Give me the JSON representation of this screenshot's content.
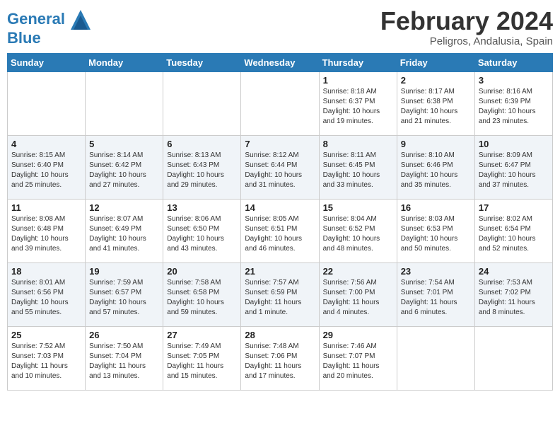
{
  "header": {
    "logo_line1": "General",
    "logo_line2": "Blue",
    "month_year": "February 2024",
    "location": "Peligros, Andalusia, Spain"
  },
  "weekdays": [
    "Sunday",
    "Monday",
    "Tuesday",
    "Wednesday",
    "Thursday",
    "Friday",
    "Saturday"
  ],
  "weeks": [
    [
      {
        "day": "",
        "info": ""
      },
      {
        "day": "",
        "info": ""
      },
      {
        "day": "",
        "info": ""
      },
      {
        "day": "",
        "info": ""
      },
      {
        "day": "1",
        "info": "Sunrise: 8:18 AM\nSunset: 6:37 PM\nDaylight: 10 hours\nand 19 minutes."
      },
      {
        "day": "2",
        "info": "Sunrise: 8:17 AM\nSunset: 6:38 PM\nDaylight: 10 hours\nand 21 minutes."
      },
      {
        "day": "3",
        "info": "Sunrise: 8:16 AM\nSunset: 6:39 PM\nDaylight: 10 hours\nand 23 minutes."
      }
    ],
    [
      {
        "day": "4",
        "info": "Sunrise: 8:15 AM\nSunset: 6:40 PM\nDaylight: 10 hours\nand 25 minutes."
      },
      {
        "day": "5",
        "info": "Sunrise: 8:14 AM\nSunset: 6:42 PM\nDaylight: 10 hours\nand 27 minutes."
      },
      {
        "day": "6",
        "info": "Sunrise: 8:13 AM\nSunset: 6:43 PM\nDaylight: 10 hours\nand 29 minutes."
      },
      {
        "day": "7",
        "info": "Sunrise: 8:12 AM\nSunset: 6:44 PM\nDaylight: 10 hours\nand 31 minutes."
      },
      {
        "day": "8",
        "info": "Sunrise: 8:11 AM\nSunset: 6:45 PM\nDaylight: 10 hours\nand 33 minutes."
      },
      {
        "day": "9",
        "info": "Sunrise: 8:10 AM\nSunset: 6:46 PM\nDaylight: 10 hours\nand 35 minutes."
      },
      {
        "day": "10",
        "info": "Sunrise: 8:09 AM\nSunset: 6:47 PM\nDaylight: 10 hours\nand 37 minutes."
      }
    ],
    [
      {
        "day": "11",
        "info": "Sunrise: 8:08 AM\nSunset: 6:48 PM\nDaylight: 10 hours\nand 39 minutes."
      },
      {
        "day": "12",
        "info": "Sunrise: 8:07 AM\nSunset: 6:49 PM\nDaylight: 10 hours\nand 41 minutes."
      },
      {
        "day": "13",
        "info": "Sunrise: 8:06 AM\nSunset: 6:50 PM\nDaylight: 10 hours\nand 43 minutes."
      },
      {
        "day": "14",
        "info": "Sunrise: 8:05 AM\nSunset: 6:51 PM\nDaylight: 10 hours\nand 46 minutes."
      },
      {
        "day": "15",
        "info": "Sunrise: 8:04 AM\nSunset: 6:52 PM\nDaylight: 10 hours\nand 48 minutes."
      },
      {
        "day": "16",
        "info": "Sunrise: 8:03 AM\nSunset: 6:53 PM\nDaylight: 10 hours\nand 50 minutes."
      },
      {
        "day": "17",
        "info": "Sunrise: 8:02 AM\nSunset: 6:54 PM\nDaylight: 10 hours\nand 52 minutes."
      }
    ],
    [
      {
        "day": "18",
        "info": "Sunrise: 8:01 AM\nSunset: 6:56 PM\nDaylight: 10 hours\nand 55 minutes."
      },
      {
        "day": "19",
        "info": "Sunrise: 7:59 AM\nSunset: 6:57 PM\nDaylight: 10 hours\nand 57 minutes."
      },
      {
        "day": "20",
        "info": "Sunrise: 7:58 AM\nSunset: 6:58 PM\nDaylight: 10 hours\nand 59 minutes."
      },
      {
        "day": "21",
        "info": "Sunrise: 7:57 AM\nSunset: 6:59 PM\nDaylight: 11 hours\nand 1 minute."
      },
      {
        "day": "22",
        "info": "Sunrise: 7:56 AM\nSunset: 7:00 PM\nDaylight: 11 hours\nand 4 minutes."
      },
      {
        "day": "23",
        "info": "Sunrise: 7:54 AM\nSunset: 7:01 PM\nDaylight: 11 hours\nand 6 minutes."
      },
      {
        "day": "24",
        "info": "Sunrise: 7:53 AM\nSunset: 7:02 PM\nDaylight: 11 hours\nand 8 minutes."
      }
    ],
    [
      {
        "day": "25",
        "info": "Sunrise: 7:52 AM\nSunset: 7:03 PM\nDaylight: 11 hours\nand 10 minutes."
      },
      {
        "day": "26",
        "info": "Sunrise: 7:50 AM\nSunset: 7:04 PM\nDaylight: 11 hours\nand 13 minutes."
      },
      {
        "day": "27",
        "info": "Sunrise: 7:49 AM\nSunset: 7:05 PM\nDaylight: 11 hours\nand 15 minutes."
      },
      {
        "day": "28",
        "info": "Sunrise: 7:48 AM\nSunset: 7:06 PM\nDaylight: 11 hours\nand 17 minutes."
      },
      {
        "day": "29",
        "info": "Sunrise: 7:46 AM\nSunset: 7:07 PM\nDaylight: 11 hours\nand 20 minutes."
      },
      {
        "day": "",
        "info": ""
      },
      {
        "day": "",
        "info": ""
      }
    ]
  ]
}
